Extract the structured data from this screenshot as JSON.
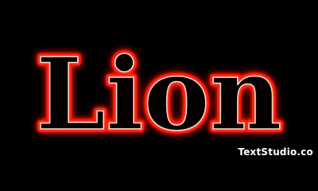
{
  "title_text": "Lion",
  "watermark": "TextStudio.co",
  "colors": {
    "background": "#000000",
    "glow": "#ff1a00",
    "stroke_outer": "#ff2a1a",
    "stroke_inner": "#ffd7c8",
    "fill": "#050000",
    "watermark": "#ffffff"
  }
}
